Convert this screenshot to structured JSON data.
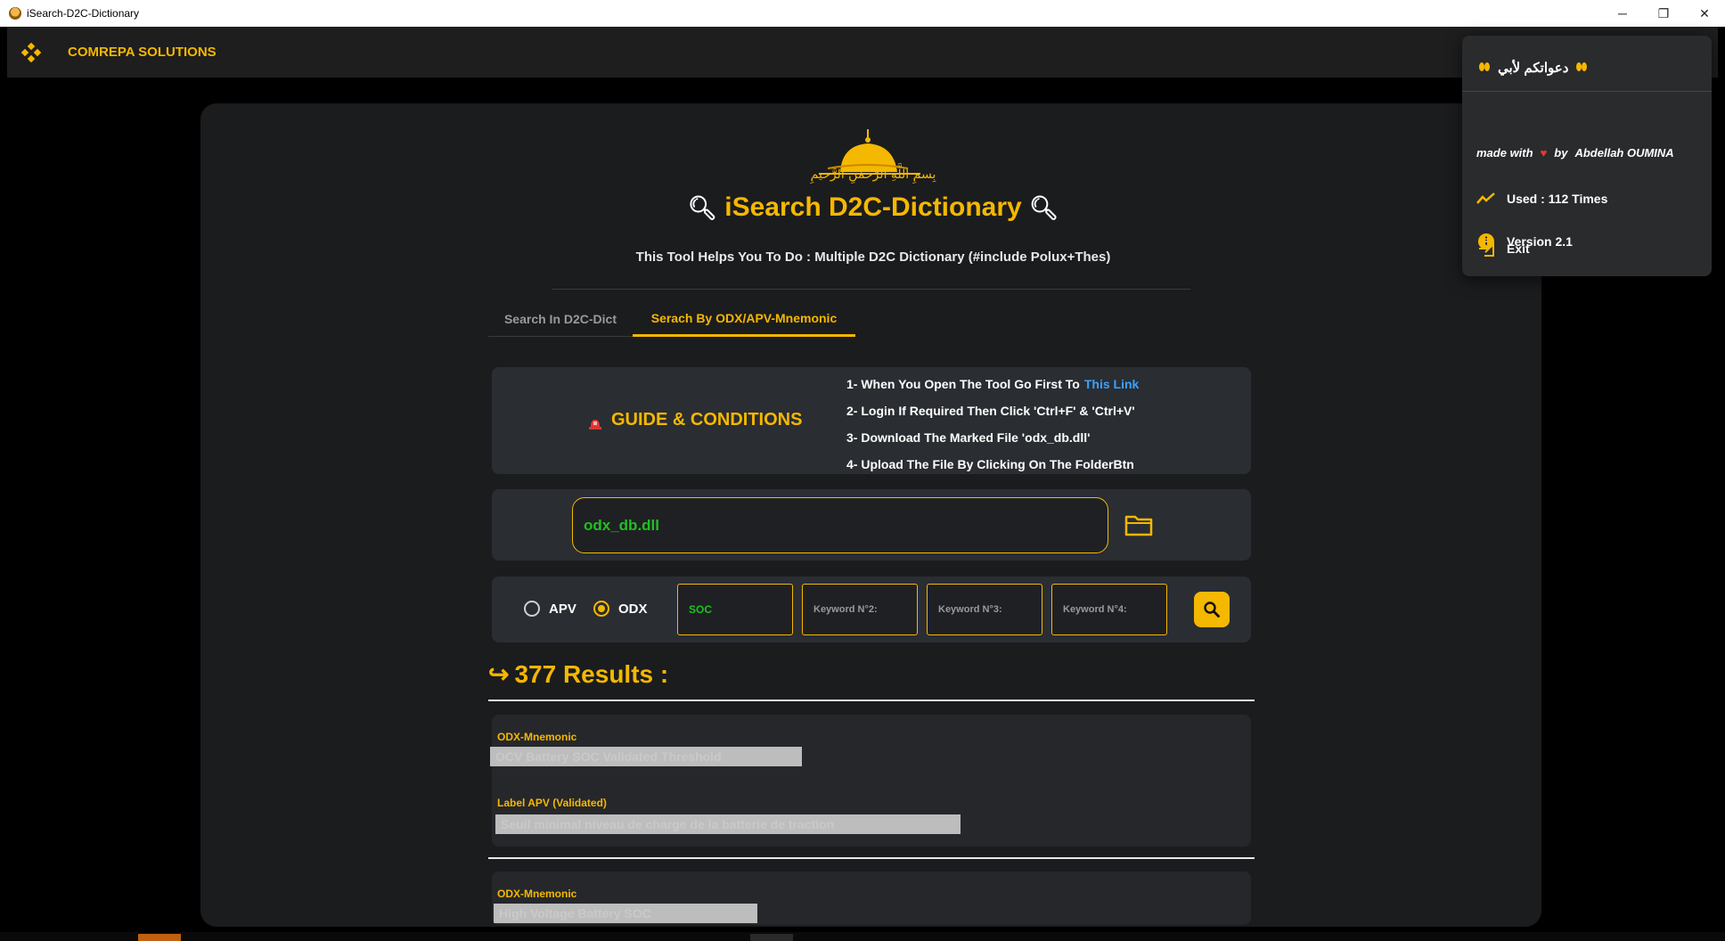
{
  "window": {
    "title": "iSearch-D2C-Dictionary",
    "minimize_glyph": "─",
    "restore_glyph": "❐",
    "close_glyph": "✕"
  },
  "header": {
    "brand": "COMREPA SOLUTIONS",
    "brand_icon": "diamond-cluster-icon"
  },
  "menu": {
    "dua": "دعواتكم لأبي",
    "made_with": "made with",
    "by": "by",
    "author": "Abdellah OUMINA",
    "used": "Used : 112 Times",
    "version": "Version 2.1",
    "exit": "Exit"
  },
  "hero": {
    "basmala": "بِسمِ اللَّهِ الرَّحمٰنِ الرَّحيمِ",
    "title": "iSearch D2C-Dictionary",
    "subtitle": "This Tool Helps You To Do : Multiple  D2C Dictionary (#include Polux+Thes)"
  },
  "tabs": [
    {
      "label": "Search In D2C-Dict",
      "active": false
    },
    {
      "label": "Serach By ODX/APV-Mnemonic",
      "active": true
    }
  ],
  "guide": {
    "heading": "GUIDE & CONDITIONS",
    "steps": [
      "1- When You Open The Tool Go First To",
      "2- Login If Required Then Click 'Ctrl+F' & 'Ctrl+V'",
      "3- Download The Marked File 'odx_db.dll'",
      "4- Upload The File By Clicking On The FolderBtn"
    ],
    "link_text": "This Link"
  },
  "file": {
    "value": "odx_db.dll"
  },
  "search": {
    "radio_apv": "APV",
    "radio_odx": "ODX",
    "selected": "ODX",
    "keyword1": "SOC",
    "keyword2_placeholder": "Keyword N°2:",
    "keyword3_placeholder": "Keyword N°3:",
    "keyword4_placeholder": "Keyword N°4:"
  },
  "results": {
    "heading": "377 Results :",
    "items": [
      {
        "label1": "ODX-Mnemonic",
        "value1": "OCV Battery SOC Validated Threshold",
        "label2": "Label APV (Validated)",
        "value2": "Seuil minimal niveau de charge de la batterie de traction"
      },
      {
        "label1": "ODX-Mnemonic",
        "value1": "High Voltage Battery SOC"
      }
    ]
  },
  "colors": {
    "accent": "#f5b800",
    "card_bg": "#1b1c1e",
    "panel_bg": "#2a2d32",
    "value_green": "#20c020",
    "link_blue": "#3ba2ff"
  }
}
